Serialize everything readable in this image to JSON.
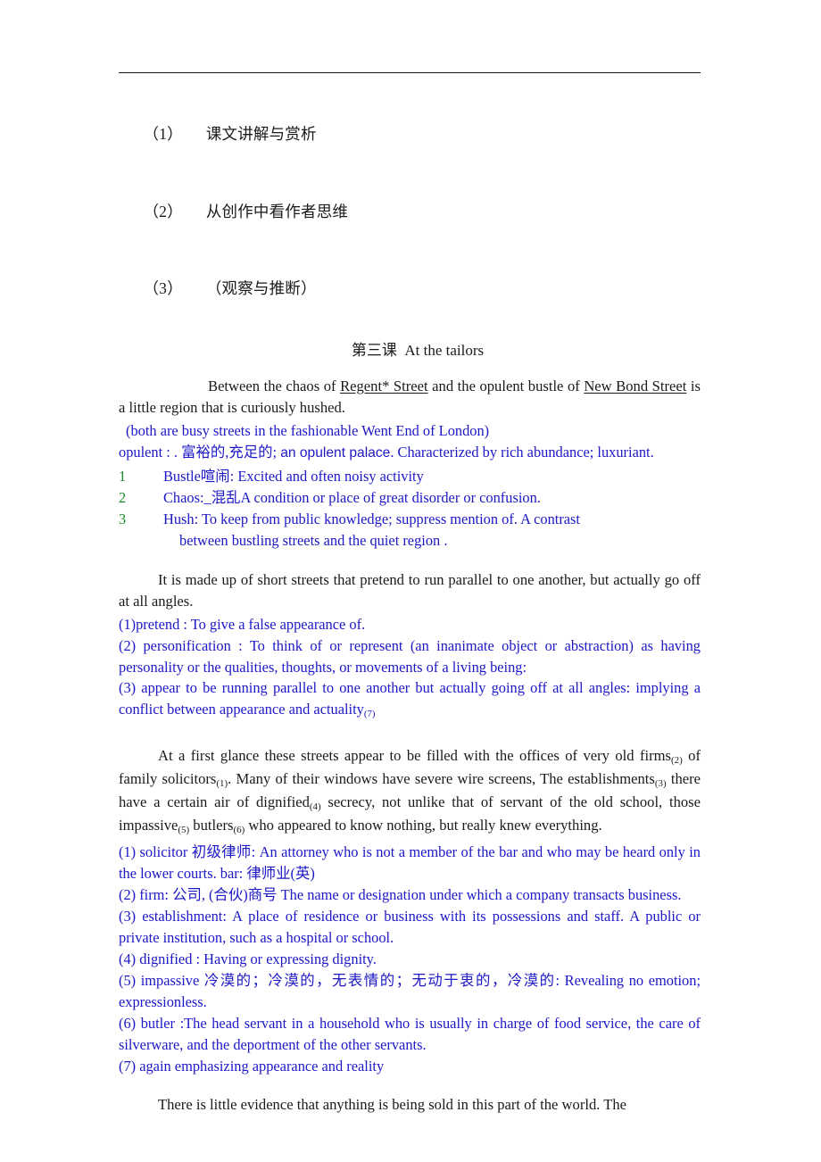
{
  "document": {
    "outline": [
      {
        "num": "（1）",
        "text": "课文讲解与赏析"
      },
      {
        "num": "（2）",
        "text": "从创作中看作者思维"
      },
      {
        "num": "（3）",
        "text": "（观察与推断）"
      }
    ],
    "lesson_title": "第三课  At the tailors",
    "para1": {
      "lead": "Between  the  chaos  of  ",
      "street1": "Regent*  Street",
      "mid": "  and  the  opulent  bustle  of  ",
      "street2": "New Bond Street",
      "tail": "   is a little region that is curiously hushed."
    },
    "gloss_streets": "(both are busy streets in the fashionable Went End of London)",
    "gloss_opulent": {
      "part1": "opulent : .  富裕的,充足的; ",
      "sans_run": "an opulent palace",
      "part2": ". Characterized by rich abundance; luxuriant."
    },
    "vocab": [
      {
        "num": "1",
        "text": "Bustle喧闹: Excited and often noisy activity"
      },
      {
        "num": "2",
        "text": "Chaos:_混乱A condition or place of great disorder or confusion."
      },
      {
        "num": "3",
        "text": "Hush: To keep from public knowledge; suppress mention of.    A contrast",
        "cont": "between bustling streets and the quiet region ."
      }
    ],
    "para2": "It is made up of short streets that pretend to run parallel to one another, but actually go off at all angles.",
    "notes2": [
      "(1)pretend : To give a false appearance of.",
      "(2) personification : To think of or represent (an inanimate object or abstraction) as having personality or the qualities, thoughts, or movements of a living being:",
      "(3) appear to be running parallel to one another but actually going off at all angles: implying a conflict between appearance and actuality"
    ],
    "notes2_last_sub": "(7)",
    "para3": {
      "s1": "At a first glance these streets appear to be filled with the offices of very old firms",
      "sub1": "(2)",
      "s2": " of family solicitors",
      "sub2": "(1)",
      "s3": ". Many of their windows have severe wire screens, The establishments",
      "sub3": "(3)",
      "s4": " there have a certain air of dignified",
      "sub4": "(4)",
      "s5": " secrecy, not unlike that of servant of the old school, those impassive",
      "sub5": "(5)",
      "s6": " butlers",
      "sub6": "(6)",
      "s7": " who appeared to know nothing, but really knew everything."
    },
    "notes3": [
      "(1) solicitor 初级律师: An attorney who is not a member of the bar and who may be heard only in the lower courts.    bar:    律师业(英)",
      "(2) firm:  公司, (合伙)商号 The name or designation under which a company transacts business.",
      "(3) establishment: A place of residence or business with its possessions and staff. A public or private institution, such as a hospital or school.",
      "(4) dignified : Having or expressing dignity.",
      "(5) impassive 冷漠的；冷漠的，无表情的；无动于衷的，冷漠的: Revealing no emotion; expressionless.",
      "(6) butler :The head servant in a household who is usually in charge of food service, the care of silverware, and the deportment of the other servants.",
      "(7) again emphasizing appearance and reality"
    ],
    "para4": "There is little evidence that anything is being sold in this part of the world. The"
  },
  "colors": {
    "gloss_blue": "#1d18c6",
    "vocab_num_green": "#1f8a2e",
    "body_black": "#1a1a1a",
    "rule": "#151515"
  }
}
